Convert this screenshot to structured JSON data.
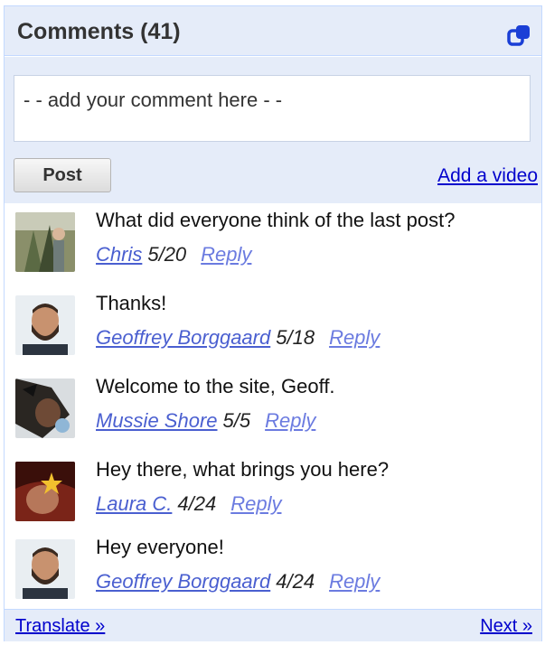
{
  "header": {
    "title": "Comments (41)",
    "popout_icon": "popout-icon",
    "accent": "#e5ecf9"
  },
  "compose": {
    "placeholder": "- - add your comment here - -",
    "post_label": "Post",
    "add_video_label": "Add a video"
  },
  "comments": [
    {
      "text": "What did everyone think of the last post?",
      "author": "Chris",
      "date": "5/20",
      "reply": "Reply",
      "avatar": "avatar-chris"
    },
    {
      "text": "Thanks!",
      "author": "Geoffrey Borggaard",
      "date": "5/18",
      "reply": "Reply",
      "avatar": "avatar-geoffrey"
    },
    {
      "text": "Welcome to the site, Geoff.",
      "author": "Mussie Shore",
      "date": "5/5",
      "reply": "Reply",
      "avatar": "avatar-mussie"
    },
    {
      "text": "Hey there, what brings you here?",
      "author": "Laura C.",
      "date": "4/24",
      "reply": "Reply",
      "avatar": "avatar-laura"
    },
    {
      "text": "Hey everyone!",
      "author": "Geoffrey Borggaard",
      "date": "4/24",
      "reply": "Reply",
      "avatar": "avatar-geoffrey"
    }
  ],
  "footer": {
    "translate_label": "Translate »",
    "next_label": "Next »"
  },
  "colors": {
    "link": "#0000cc",
    "author_link": "#4a5fd0",
    "panel_bg": "#e5ecf9",
    "border": "#c3d9ff"
  }
}
